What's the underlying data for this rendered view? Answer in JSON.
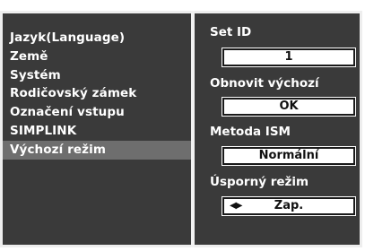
{
  "menu": {
    "items": [
      {
        "label": "Jazyk(Language)",
        "selected": false
      },
      {
        "label": "Země",
        "selected": false
      },
      {
        "label": "Systém",
        "selected": false
      },
      {
        "label": "Rodičovský zámek",
        "selected": false
      },
      {
        "label": "Označení vstupu",
        "selected": false
      },
      {
        "label": "SIMPLINK",
        "selected": false
      },
      {
        "label": "Výchozí režim",
        "selected": true
      }
    ]
  },
  "settings": {
    "set_id": {
      "label": "Set ID",
      "value": "1"
    },
    "factory_reset": {
      "label": "Obnovit výchozí",
      "value": "OK"
    },
    "ism_method": {
      "label": "Metoda ISM",
      "value": "Normální"
    },
    "power_saving": {
      "label": "Úsporný režim",
      "value": "Zap.",
      "arrows_icon": "left-right-arrows-icon"
    }
  },
  "colors": {
    "panel_background": "#3a3a3a",
    "selection_highlight": "#6e6e6e",
    "frame": "#eeeeee",
    "text": "#ffffff"
  }
}
